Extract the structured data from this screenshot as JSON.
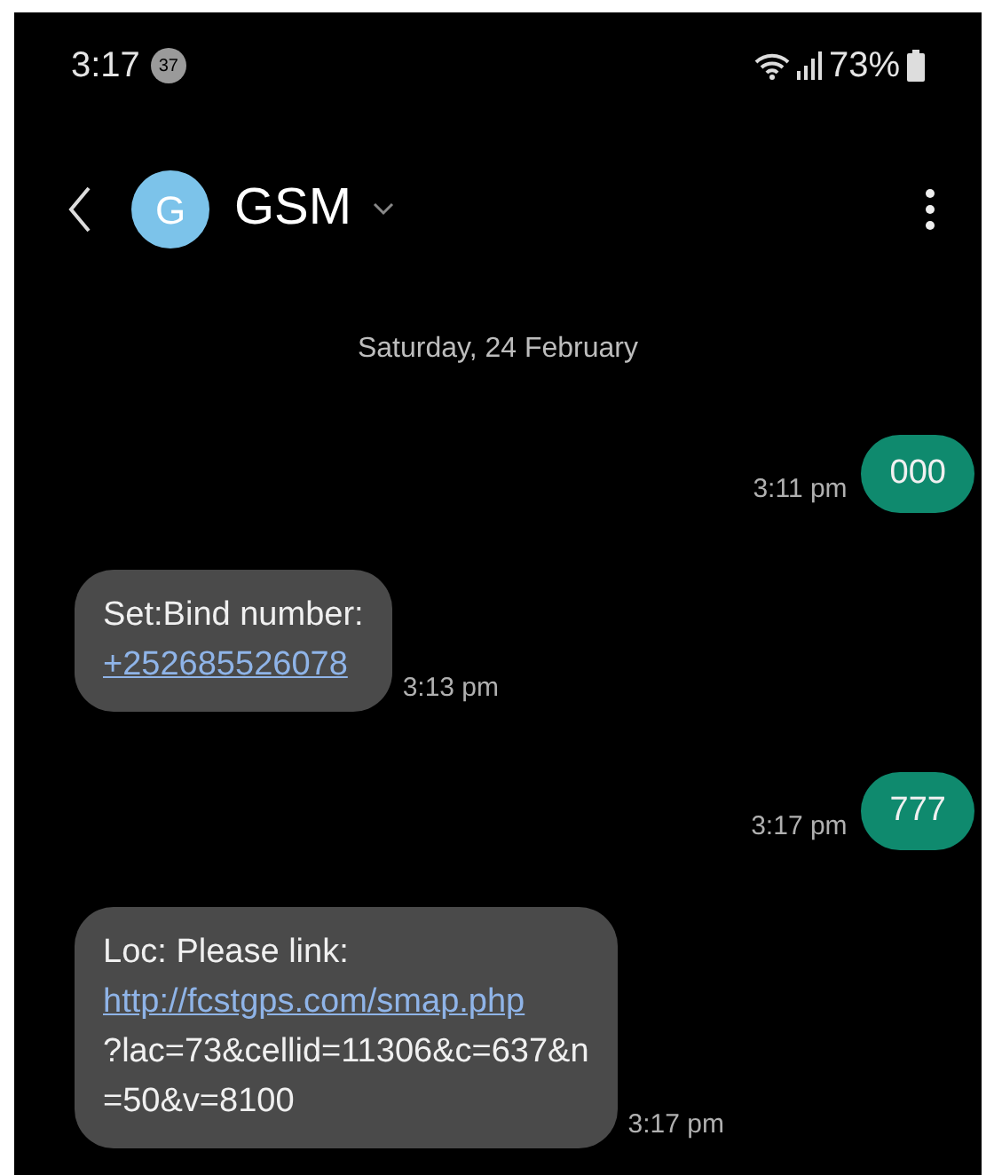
{
  "status_bar": {
    "time": "3:17",
    "notification_count": "37",
    "battery": "73%"
  },
  "header": {
    "avatar_letter": "G",
    "contact": "GSM"
  },
  "date_divider": "Saturday, 24 February",
  "messages": [
    {
      "kind": "sent",
      "lines": [
        {
          "kind": "text",
          "text": "000"
        }
      ],
      "time": "3:11 pm"
    },
    {
      "kind": "received",
      "lines": [
        {
          "kind": "text",
          "text": "Set:Bind number:"
        },
        {
          "kind": "link",
          "text": "+252685526078"
        }
      ],
      "time": "3:13 pm"
    },
    {
      "kind": "sent",
      "lines": [
        {
          "kind": "text",
          "text": "777"
        }
      ],
      "time": "3:17 pm"
    },
    {
      "kind": "received",
      "lines": [
        {
          "kind": "text",
          "text": "Loc: Please link:"
        },
        {
          "kind": "link",
          "text": "http://fcstgps.com/smap.php"
        },
        {
          "kind": "text",
          "text": "?lac=73&cellid=11306&c=637&n"
        },
        {
          "kind": "text",
          "text": "=50&v=8100"
        }
      ],
      "time": "3:17 pm"
    }
  ]
}
